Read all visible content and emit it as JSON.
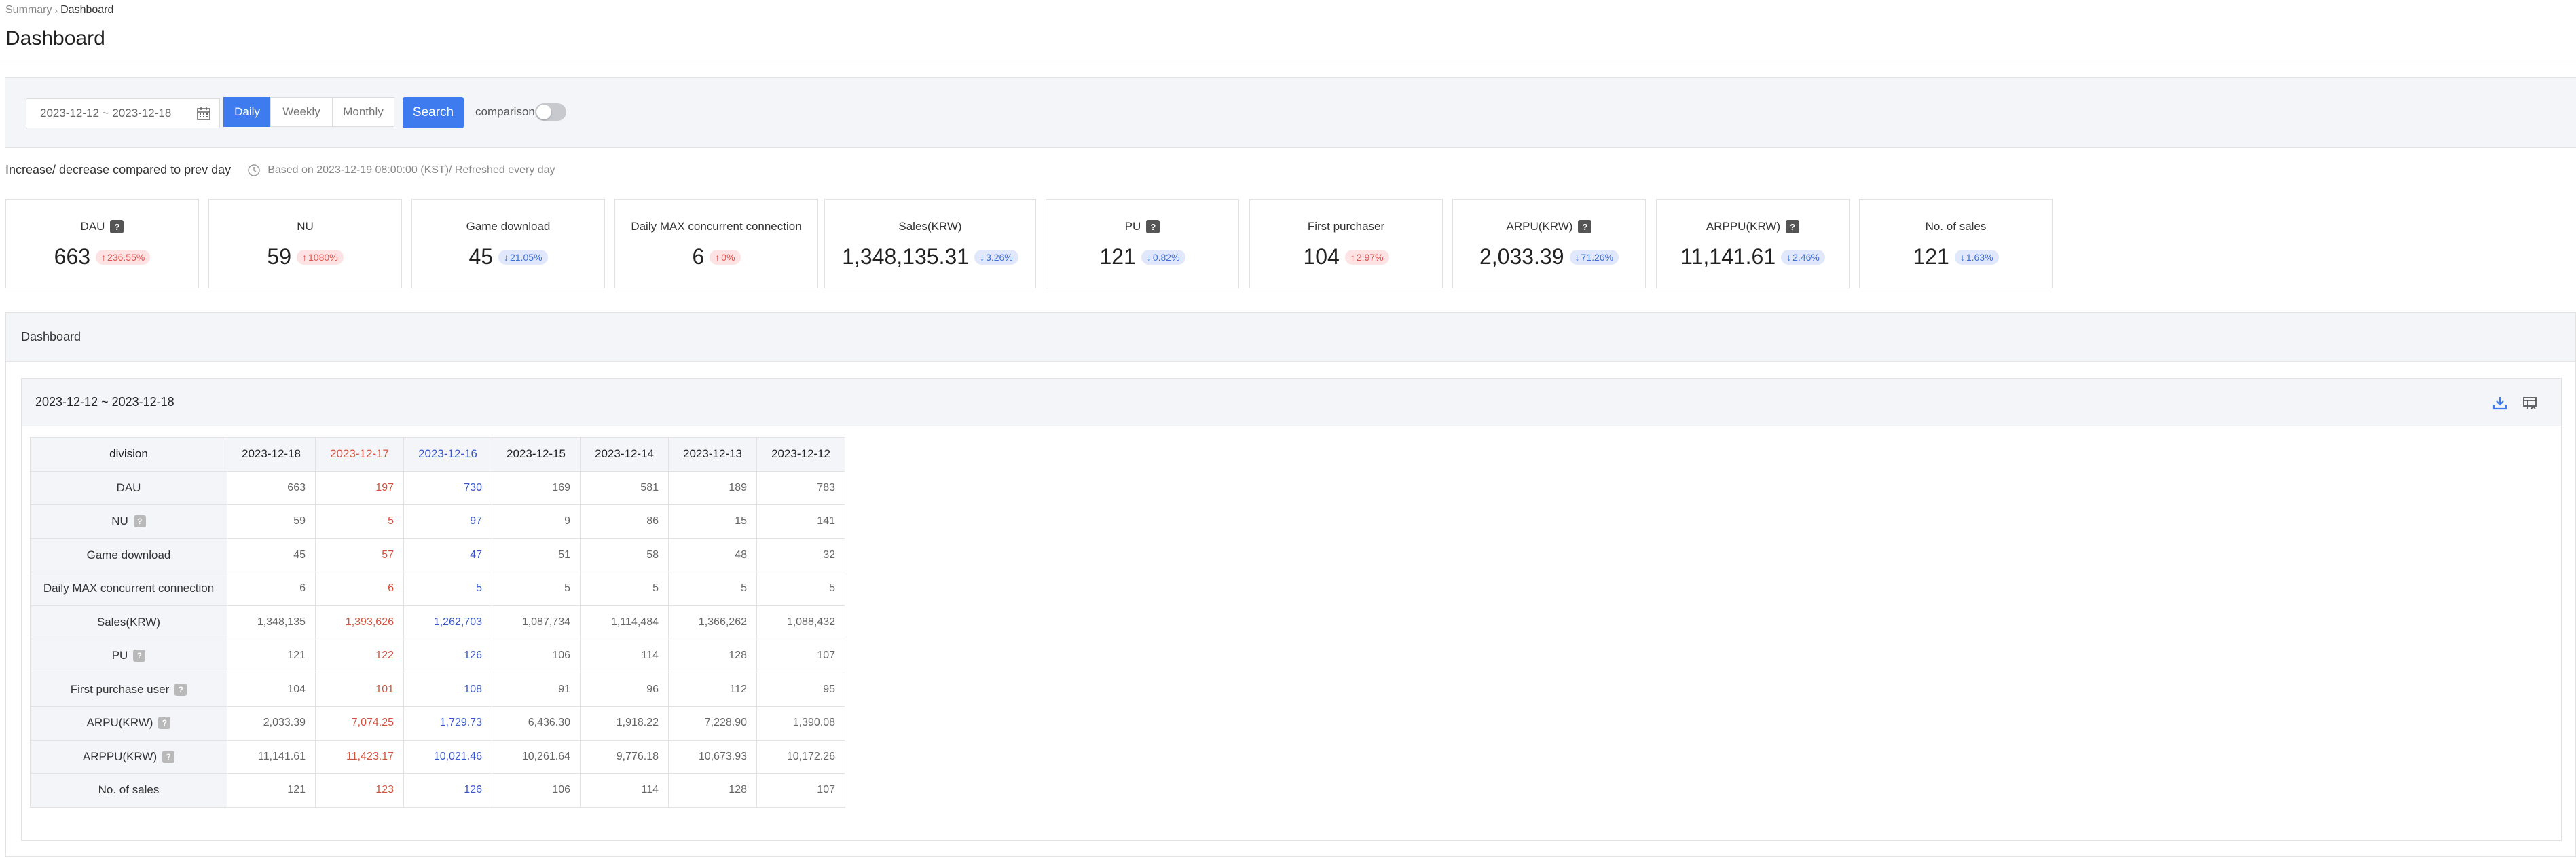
{
  "breadcrumb": {
    "parent": "Summary",
    "current": "Dashboard"
  },
  "page_title": "Dashboard",
  "filter": {
    "date_range": "2023-12-12 ~ 2023-12-18",
    "periods": [
      "Daily",
      "Weekly",
      "Monthly"
    ],
    "active_period": "Daily",
    "search_label": "Search",
    "comparison_label": "comparison",
    "comparison_on": false
  },
  "info": {
    "title": "Increase/ decrease compared to prev day",
    "note": "Based on 2023-12-19 08:00:00 (KST)/ Refreshed every day"
  },
  "colors": {
    "accent": "#3d7bef",
    "up": "#e0524f",
    "down": "#3e6fd8",
    "sunday": "#d4533f",
    "saturday": "#3a55c8"
  },
  "kpis": [
    {
      "label": "DAU",
      "help": "?",
      "value": "663",
      "change": "236.55%",
      "dir": "up"
    },
    {
      "label": "NU",
      "help": "",
      "value": "59",
      "change": "1080%",
      "dir": "up"
    },
    {
      "label": "Game download",
      "help": "",
      "value": "45",
      "change": "21.05%",
      "dir": "down"
    },
    {
      "label": "Daily MAX concurrent connection",
      "help": "",
      "value": "6",
      "change": "0%",
      "dir": "up"
    },
    {
      "label": "Sales(KRW)",
      "help": "",
      "value": "1,348,135.31",
      "change": "3.26%",
      "dir": "down"
    },
    {
      "label": "PU",
      "help": "?",
      "value": "121",
      "change": "0.82%",
      "dir": "down"
    },
    {
      "label": "First purchaser",
      "help": "",
      "value": "104",
      "change": "2.97%",
      "dir": "up"
    },
    {
      "label": "ARPU(KRW)",
      "help": "?",
      "value": "2,033.39",
      "change": "71.26%",
      "dir": "down"
    },
    {
      "label": "ARPPU(KRW)",
      "help": "?",
      "value": "11,141.61",
      "change": "2.46%",
      "dir": "down"
    },
    {
      "label": "No. of sales",
      "help": "",
      "value": "121",
      "change": "1.63%",
      "dir": "down"
    }
  ],
  "section": {
    "title": "Dashboard",
    "range": "2023-12-12 ~ 2023-12-18",
    "download_icon": "download-icon",
    "column_settings_icon": "column-settings-icon"
  },
  "table": {
    "division_label": "division",
    "dates": [
      "2023-12-18",
      "2023-12-17",
      "2023-12-16",
      "2023-12-15",
      "2023-12-14",
      "2023-12-13",
      "2023-12-12"
    ],
    "date_kinds": [
      "",
      "sun",
      "sat",
      "",
      "",
      "",
      ""
    ],
    "rows": [
      {
        "label": "DAU",
        "help": "",
        "values": [
          "663",
          "197",
          "730",
          "169",
          "581",
          "189",
          "783"
        ]
      },
      {
        "label": "NU",
        "help": "?",
        "values": [
          "59",
          "5",
          "97",
          "9",
          "86",
          "15",
          "141"
        ]
      },
      {
        "label": "Game download",
        "help": "",
        "values": [
          "45",
          "57",
          "47",
          "51",
          "58",
          "48",
          "32"
        ]
      },
      {
        "label": "Daily MAX concurrent connection",
        "help": "",
        "values": [
          "6",
          "6",
          "5",
          "5",
          "5",
          "5",
          "5"
        ]
      },
      {
        "label": "Sales(KRW)",
        "help": "",
        "values": [
          "1,348,135",
          "1,393,626",
          "1,262,703",
          "1,087,734",
          "1,114,484",
          "1,366,262",
          "1,088,432"
        ]
      },
      {
        "label": "PU",
        "help": "?",
        "values": [
          "121",
          "122",
          "126",
          "106",
          "114",
          "128",
          "107"
        ]
      },
      {
        "label": "First purchase user",
        "help": "?",
        "values": [
          "104",
          "101",
          "108",
          "91",
          "96",
          "112",
          "95"
        ]
      },
      {
        "label": "ARPU(KRW)",
        "help": "?",
        "values": [
          "2,033.39",
          "7,074.25",
          "1,729.73",
          "6,436.30",
          "1,918.22",
          "7,228.90",
          "1,390.08"
        ]
      },
      {
        "label": "ARPPU(KRW)",
        "help": "?",
        "values": [
          "11,141.61",
          "11,423.17",
          "10,021.46",
          "10,261.64",
          "9,776.18",
          "10,673.93",
          "10,172.26"
        ]
      },
      {
        "label": "No. of sales",
        "help": "",
        "values": [
          "121",
          "123",
          "126",
          "106",
          "114",
          "128",
          "107"
        ]
      }
    ]
  }
}
